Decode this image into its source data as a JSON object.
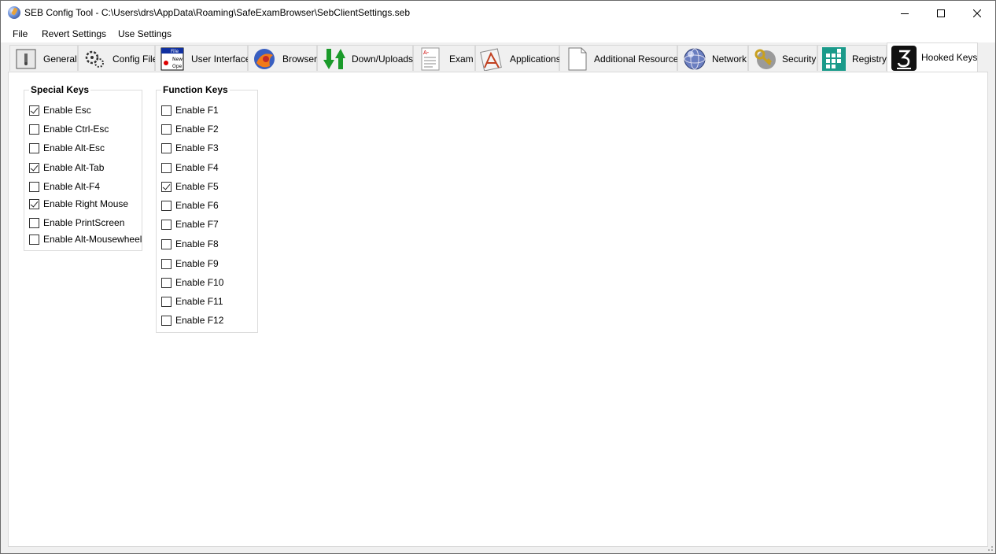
{
  "window": {
    "title": "SEB Config Tool - C:\\Users\\drs\\AppData\\Roaming\\SafeExamBrowser\\SebClientSettings.seb",
    "icon": "seb-app-icon"
  },
  "menu": [
    {
      "label": "File"
    },
    {
      "label": "Revert Settings"
    },
    {
      "label": "Use Settings"
    }
  ],
  "tabs": [
    {
      "label": "General",
      "icon": "general-icon"
    },
    {
      "label": "Config File",
      "icon": "config-file-icon"
    },
    {
      "label": "User Interface",
      "icon": "user-interface-icon"
    },
    {
      "label": "Browser",
      "icon": "browser-icon"
    },
    {
      "label": "Down/Uploads",
      "icon": "down-uploads-icon"
    },
    {
      "label": "Exam",
      "icon": "exam-icon"
    },
    {
      "label": "Applications",
      "icon": "applications-icon"
    },
    {
      "label": "Additional Resources",
      "icon": "additional-resources-icon"
    },
    {
      "label": "Network",
      "icon": "network-icon"
    },
    {
      "label": "Security",
      "icon": "security-icon"
    },
    {
      "label": "Registry",
      "icon": "registry-icon"
    },
    {
      "label": "Hooked Keys",
      "icon": "hooked-keys-icon",
      "selected": true
    }
  ],
  "special_keys": {
    "title": "Special Keys",
    "items": [
      {
        "label": "Enable Esc",
        "checked": true
      },
      {
        "label": "Enable Ctrl-Esc",
        "checked": false
      },
      {
        "label": "Enable Alt-Esc",
        "checked": false
      },
      {
        "label": "Enable Alt-Tab",
        "checked": true
      },
      {
        "label": "Enable Alt-F4",
        "checked": false
      },
      {
        "label": "Enable Right Mouse",
        "checked": true
      },
      {
        "label": "Enable PrintScreen",
        "checked": false
      },
      {
        "label": "Enable Alt-Mousewheel",
        "checked": false
      }
    ]
  },
  "function_keys": {
    "title": "Function Keys",
    "items": [
      {
        "label": "Enable F1",
        "checked": false
      },
      {
        "label": "Enable F2",
        "checked": false
      },
      {
        "label": "Enable F3",
        "checked": false
      },
      {
        "label": "Enable F4",
        "checked": false
      },
      {
        "label": "Enable F5",
        "checked": true
      },
      {
        "label": "Enable F6",
        "checked": false
      },
      {
        "label": "Enable F7",
        "checked": false
      },
      {
        "label": "Enable F8",
        "checked": false
      },
      {
        "label": "Enable F9",
        "checked": false
      },
      {
        "label": "Enable F10",
        "checked": false
      },
      {
        "label": "Enable F11",
        "checked": false
      },
      {
        "label": "Enable F12",
        "checked": false
      }
    ]
  }
}
